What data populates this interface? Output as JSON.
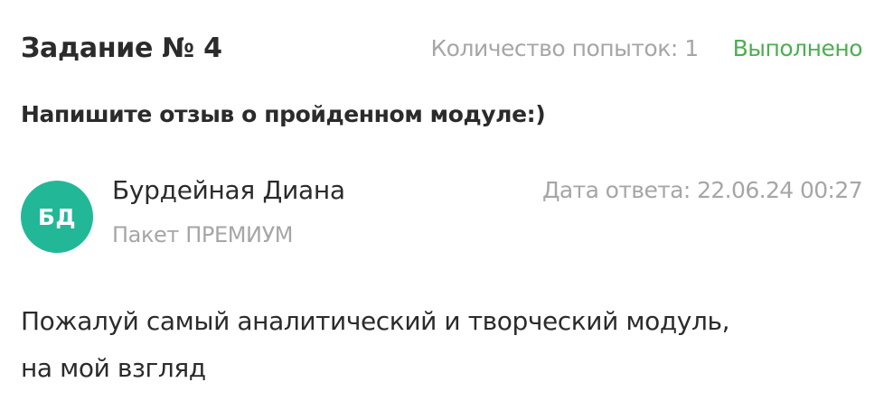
{
  "task": {
    "title": "Задание № 4",
    "attempts": "Количество попыток: 1",
    "status": "Выполнено"
  },
  "question": "Напишите отзыв о пройденном модуле:)",
  "answer": {
    "avatar_initials": "БД",
    "author_name": "Бурдейная Диана",
    "package": "Пакет ПРЕМИУМ",
    "date": "Дата ответа: 22.06.24 00:27",
    "text_line1": "Пожалуй самый аналитический и творческий модуль,",
    "text_line2": "на мой взгляд"
  },
  "colors": {
    "avatar_bg": "#22b897",
    "status_green": "#4caf50",
    "muted_text": "#a6a6a6",
    "main_text": "#2b2b2b"
  }
}
